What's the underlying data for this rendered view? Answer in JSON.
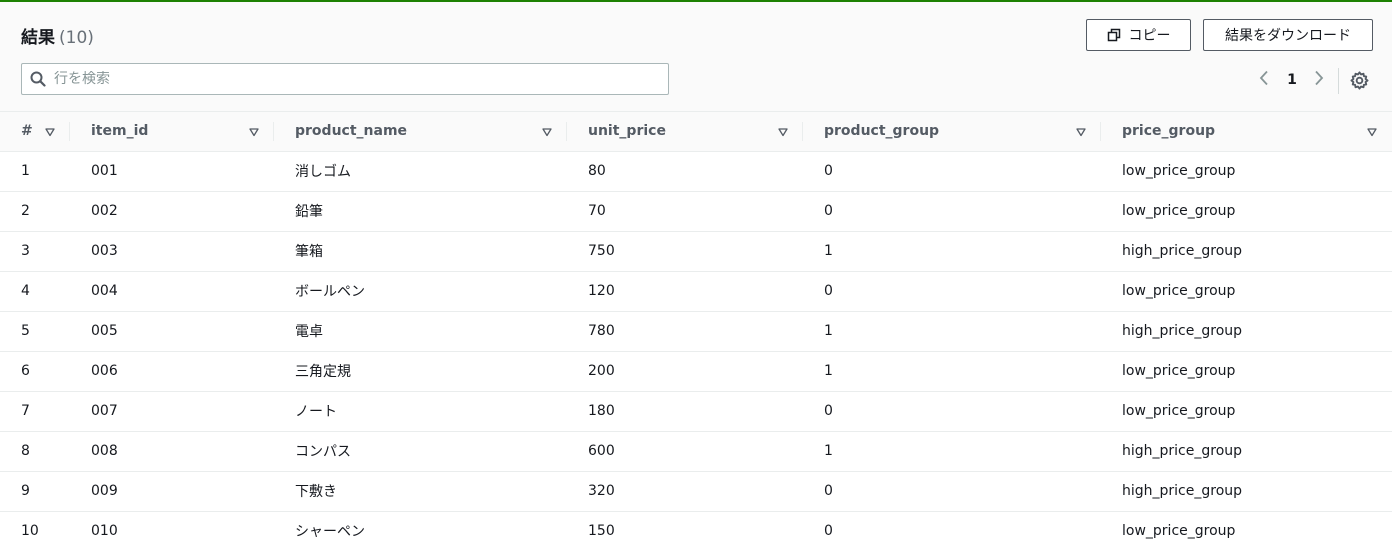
{
  "header": {
    "title": "結果",
    "count": "(10)",
    "copy_label": "コピー",
    "download_label": "結果をダウンロード"
  },
  "search": {
    "placeholder": "行を検索",
    "value": ""
  },
  "pagination": {
    "current_page": "1"
  },
  "columns": [
    "#",
    "item_id",
    "product_name",
    "unit_price",
    "product_group",
    "price_group"
  ],
  "rows": [
    [
      "1",
      "001",
      "消しゴム",
      "80",
      "0",
      "low_price_group"
    ],
    [
      "2",
      "002",
      "鉛筆",
      "70",
      "0",
      "low_price_group"
    ],
    [
      "3",
      "003",
      "筆箱",
      "750",
      "1",
      "high_price_group"
    ],
    [
      "4",
      "004",
      "ボールペン",
      "120",
      "0",
      "low_price_group"
    ],
    [
      "5",
      "005",
      "電卓",
      "780",
      "1",
      "high_price_group"
    ],
    [
      "6",
      "006",
      "三角定規",
      "200",
      "1",
      "low_price_group"
    ],
    [
      "7",
      "007",
      "ノート",
      "180",
      "0",
      "low_price_group"
    ],
    [
      "8",
      "008",
      "コンパス",
      "600",
      "1",
      "high_price_group"
    ],
    [
      "9",
      "009",
      "下敷き",
      "320",
      "0",
      "high_price_group"
    ],
    [
      "10",
      "010",
      "シャーペン",
      "150",
      "0",
      "low_price_group"
    ]
  ],
  "icons": {
    "copy": "copy-icon",
    "search": "search-icon",
    "prev": "chevron-left-icon",
    "next": "chevron-right-icon",
    "settings": "gear-icon",
    "sort": "sort-triangle-icon"
  },
  "colors": {
    "accent_line": "#1d8102",
    "header_bg": "#fafafa",
    "text": "#16191f",
    "muted": "#687078"
  }
}
